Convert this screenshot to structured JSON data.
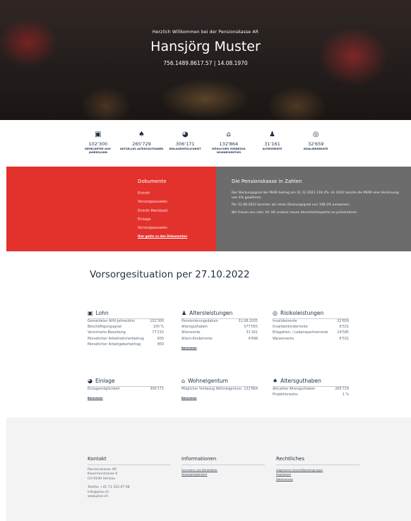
{
  "hero": {
    "welcome": "Herzlich Willkommen bei der Pensionskasse AR",
    "name": "Hansjörg Muster",
    "meta": "756.1489.8617.57 | 14.08.1970"
  },
  "stats": [
    {
      "icon": "banknote-icon",
      "glyph": "▣",
      "value": "102'300",
      "label": "Gemeldeter AHV-Jahreslohn"
    },
    {
      "icon": "piggy-bank-icon",
      "glyph": "♠",
      "value": "265'729",
      "label": "Aktuelles Altersguthaben"
    },
    {
      "icon": "gauge-icon",
      "glyph": "◕",
      "value": "306'171",
      "label": "Einlagemöglichkeit"
    },
    {
      "icon": "house-icon",
      "glyph": "⌂",
      "value": "132'864",
      "label": "Möglicher Vorbezug Wohneigentum"
    },
    {
      "icon": "person-icon",
      "glyph": "♟",
      "value": "31'161",
      "label": "Altersrente"
    },
    {
      "icon": "shield-icon",
      "glyph": "◎",
      "value": "32'659",
      "label": "Invalidenrente"
    }
  ],
  "documents": {
    "title": "Dokumente",
    "links": [
      "Eintritt",
      "Vorsorgeausweis",
      "Eintritt Merkblatt",
      "Einlage",
      "Vorsorgeausweis"
    ],
    "all_link": "Hier gehts zu den Dokumenten"
  },
  "numbers": {
    "title": "Die Pensionskasse in Zahlen",
    "paragraphs": [
      "Der Deckungsgrad der PKAR betrug am 31.12.2021 119.2%. Im 2021 konnte die PKAR eine Verzinsung von 4% gewähren.",
      "Per 31.08.2022 konnten wir einen Deckungsgrad von 108.3% ausweisen.",
      "Wir freuen uns sehr, Ihr VK unserer neues Versichertenportal zu präsentieren"
    ]
  },
  "situation": {
    "title": "Vorsorgesituation per 27.10.2022",
    "blocks": {
      "lohn": {
        "title": "Lohn",
        "icon": "banknote-icon",
        "rows": [
          [
            "Gemeldeter AHV-Jahreslohn",
            "102'300"
          ],
          [
            "Beschäftigungsgrad",
            "100 %"
          ],
          [
            "Versicherte Besoldung",
            "77'210"
          ],
          [
            "Monatlicher Arbeitnehmerbeitrag",
            "830"
          ],
          [
            "Monatlicher Arbeitgeberbeitrag",
            "859"
          ]
        ]
      },
      "alter": {
        "title": "Altersleistungen",
        "icon": "person-icon",
        "rows": [
          [
            "Pensionierungsdatum",
            "31.08.2035"
          ],
          [
            "Altersguthaben",
            "577'055"
          ],
          [
            "Altersrente",
            "31'161"
          ],
          [
            "Alters-Kinderrente",
            "4'698"
          ]
        ],
        "calc": "Berechnen"
      },
      "risiko": {
        "title": "Risikoleistungen",
        "icon": "shield-icon",
        "rows": [
          [
            "Invalidenrente",
            "32'659"
          ],
          [
            "Invalidenkinderrente",
            "6'531"
          ],
          [
            "Ehegatten- / Lebenspartnerrente",
            "19'595"
          ],
          [
            "Waisenrente",
            "6'531"
          ]
        ]
      },
      "einlage": {
        "title": "Einlage",
        "icon": "gauge-icon",
        "rows": [
          [
            "Einlagemöglichkeit",
            "306'171"
          ]
        ],
        "calc": "Berechnen"
      },
      "wohn": {
        "title": "Wohneigentum",
        "icon": "house-icon",
        "rows": [
          [
            "Möglicher Vorbezug Wohneigentum",
            "132'864"
          ]
        ],
        "calc": "Berechnen"
      },
      "guthaben": {
        "title": "Altersguthaben",
        "icon": "piggy-bank-icon",
        "rows": [
          [
            "Aktuelles Altersguthaben",
            "265'729"
          ],
          [
            "Projektionszins",
            "1 %"
          ]
        ]
      }
    }
  },
  "footer": {
    "kontakt": {
      "title": "Kontakt",
      "lines": [
        "Pensionskasse AR",
        "Kasernenstrasse 6",
        "CH-9100 Herisau"
      ],
      "lines2": [
        "Telefon +41 71 353 67 08",
        "info@pkar.ch",
        "www.pkar.ch"
      ]
    },
    "info": {
      "title": "Informationen",
      "links": [
        "Formulare und Merkblätter",
        "Vorsorgereglement"
      ]
    },
    "recht": {
      "title": "Rechtliches",
      "links": [
        "Allgemeine Geschäftsbedingungen",
        "Impressum",
        "Datenschutz"
      ]
    }
  }
}
